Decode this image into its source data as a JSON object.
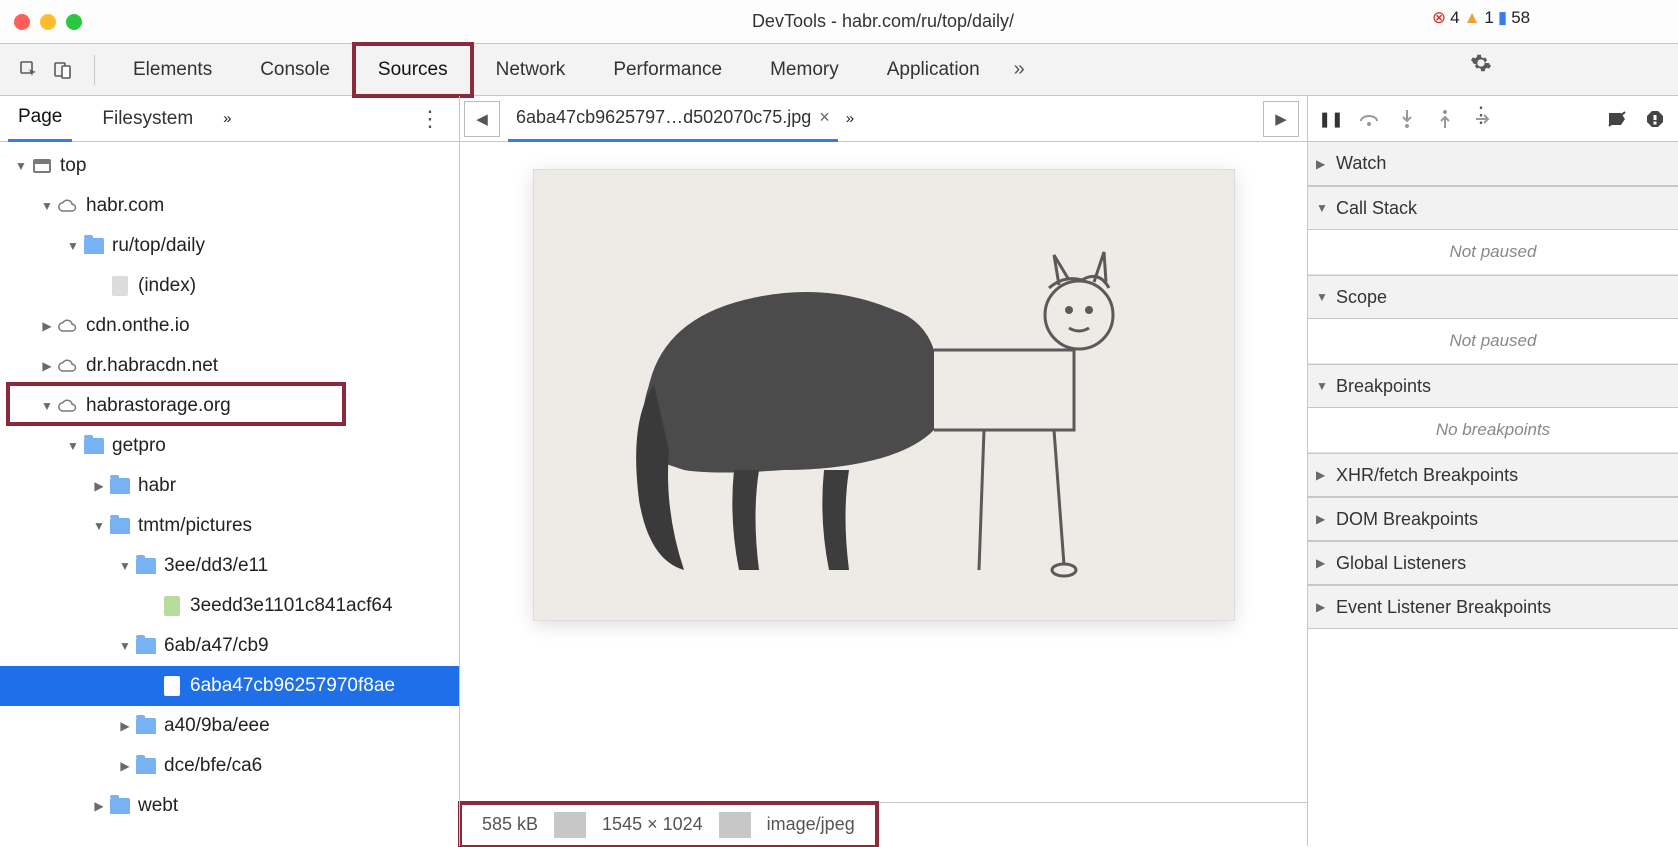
{
  "title": "DevTools - habr.com/ru/top/daily/",
  "tabs": [
    "Elements",
    "Console",
    "Sources",
    "Network",
    "Performance",
    "Memory",
    "Application"
  ],
  "active_tab": "Sources",
  "counters": {
    "errors": 4,
    "warnings": 1,
    "messages": 58
  },
  "left": {
    "tabs": [
      "Page",
      "Filesystem"
    ],
    "active": "Page",
    "tree": [
      {
        "d": 0,
        "a": "d",
        "i": "win",
        "l": "top"
      },
      {
        "d": 1,
        "a": "d",
        "i": "cloud",
        "l": "habr.com"
      },
      {
        "d": 2,
        "a": "d",
        "i": "folder",
        "l": "ru/top/daily"
      },
      {
        "d": 3,
        "a": "",
        "i": "file",
        "l": "(index)"
      },
      {
        "d": 1,
        "a": "r",
        "i": "cloud",
        "l": "cdn.onthe.io"
      },
      {
        "d": 1,
        "a": "r",
        "i": "cloud",
        "l": "dr.habracdn.net"
      },
      {
        "d": 1,
        "a": "d",
        "i": "cloud",
        "l": "habrastorage.org",
        "hl": true
      },
      {
        "d": 2,
        "a": "d",
        "i": "folder",
        "l": "getpro"
      },
      {
        "d": 3,
        "a": "r",
        "i": "folder",
        "l": "habr"
      },
      {
        "d": 3,
        "a": "d",
        "i": "folder",
        "l": "tmtm/pictures"
      },
      {
        "d": 4,
        "a": "d",
        "i": "folder",
        "l": "3ee/dd3/e11"
      },
      {
        "d": 5,
        "a": "",
        "i": "gfile",
        "l": "3eedd3e1101c841acf64"
      },
      {
        "d": 4,
        "a": "d",
        "i": "folder",
        "l": "6ab/a47/cb9"
      },
      {
        "d": 5,
        "a": "",
        "i": "wfile",
        "l": "6aba47cb96257970f8ae",
        "sel": true
      },
      {
        "d": 4,
        "a": "r",
        "i": "folder",
        "l": "a40/9ba/eee"
      },
      {
        "d": 4,
        "a": "r",
        "i": "folder",
        "l": "dce/bfe/ca6"
      },
      {
        "d": 3,
        "a": "r",
        "i": "folder",
        "l": "webt"
      }
    ]
  },
  "center": {
    "file_tab": "6aba47cb9625797…d502070c75.jpg",
    "footer": {
      "size": "585 kB",
      "dims": "1545 × 1024",
      "mime": "image/jpeg"
    }
  },
  "right": {
    "sections": [
      {
        "l": "Watch",
        "a": "r"
      },
      {
        "l": "Call Stack",
        "a": "d",
        "body": "Not paused"
      },
      {
        "l": "Scope",
        "a": "d",
        "body": "Not paused"
      },
      {
        "l": "Breakpoints",
        "a": "d",
        "body": "No breakpoints"
      },
      {
        "l": "XHR/fetch Breakpoints",
        "a": "r"
      },
      {
        "l": "DOM Breakpoints",
        "a": "r"
      },
      {
        "l": "Global Listeners",
        "a": "r"
      },
      {
        "l": "Event Listener Breakpoints",
        "a": "r"
      }
    ]
  }
}
